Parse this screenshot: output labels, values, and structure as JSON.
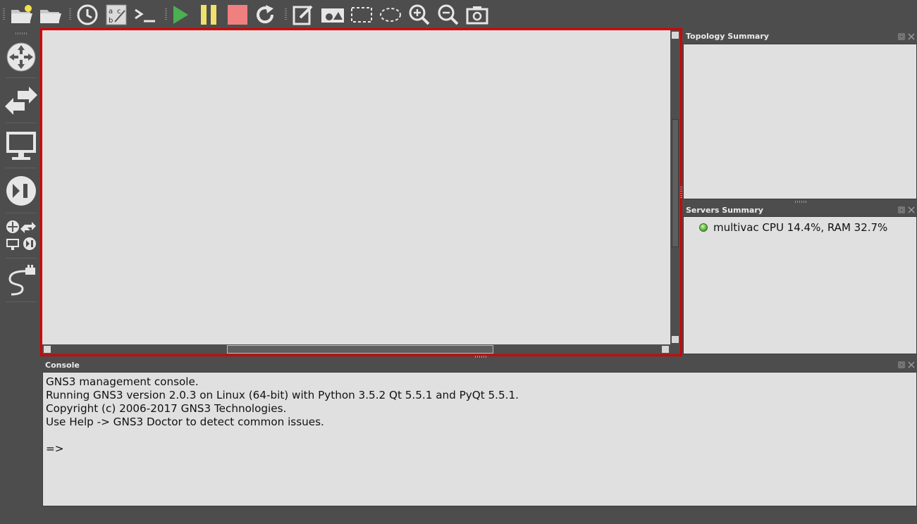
{
  "toolbar": {
    "buttons": [
      "new-project-icon",
      "open-project-icon",
      "snapshot-icon",
      "show-interface-labels-icon",
      "console-all-icon",
      "start-all-icon",
      "suspend-all-icon",
      "stop-all-icon",
      "reload-all-icon",
      "add-note-icon",
      "insert-picture-icon",
      "draw-rectangle-icon",
      "draw-ellipse-icon",
      "zoom-in-icon",
      "zoom-out-icon",
      "screenshot-icon"
    ],
    "colors": {
      "start": "#4caf50",
      "suspend": "#f0e06c",
      "stop": "#f08080"
    }
  },
  "device_dock": {
    "items": [
      "routers-icon",
      "switches-icon",
      "end-devices-icon",
      "security-devices-icon",
      "all-devices-icon",
      "add-link-icon"
    ]
  },
  "topology_summary": {
    "title": "Topology Summary"
  },
  "servers_summary": {
    "title": "Servers Summary",
    "servers": [
      {
        "name": "multivac CPU 14.4%, RAM 32.7%",
        "status": "running"
      }
    ]
  },
  "console": {
    "title": "Console",
    "lines": [
      "GNS3 management console.",
      "Running GNS3 version 2.0.3 on Linux (64-bit) with Python 3.5.2 Qt 5.5.1 and PyQt 5.5.1.",
      "Copyright (c) 2006-2017 GNS3 Technologies.",
      "Use Help -> GNS3 Doctor to detect common issues.",
      "",
      "=>"
    ]
  },
  "canvas": {
    "highlight_color": "#d40000"
  }
}
